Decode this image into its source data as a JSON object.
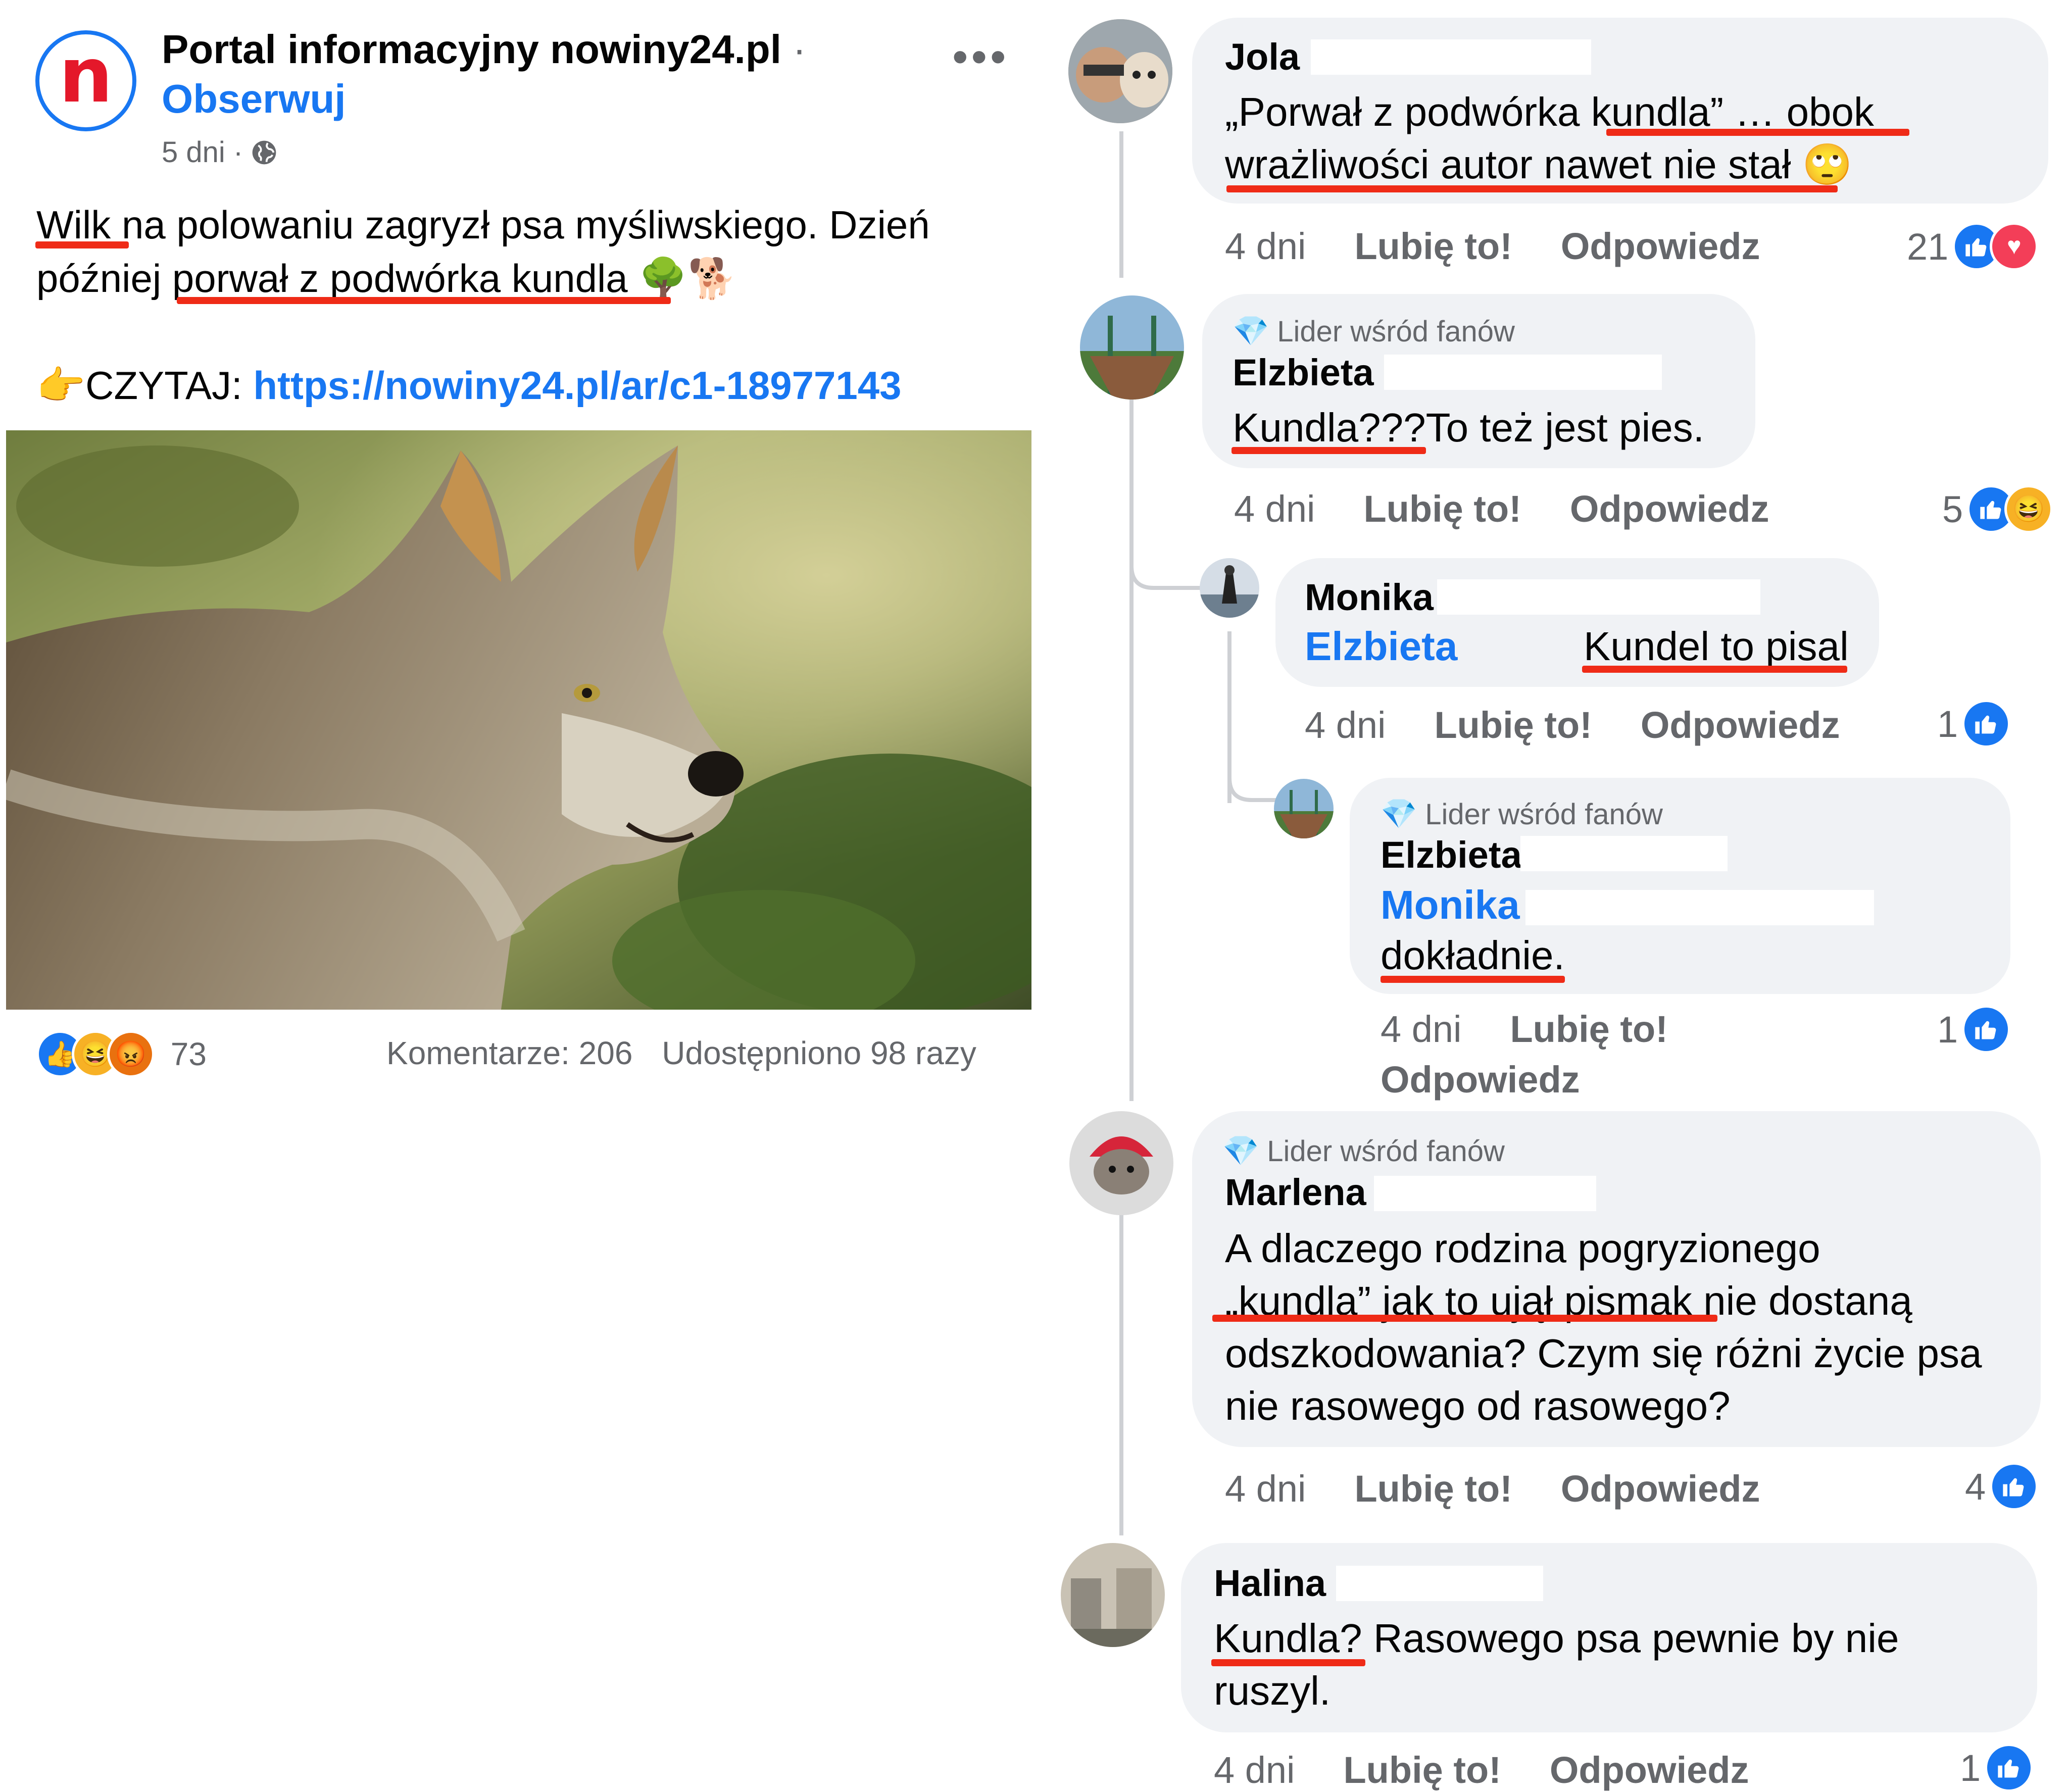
{
  "post": {
    "page_name": "Portal informacyjny nowiny24.pl",
    "separator": "·",
    "follow_label": "Obserwuj",
    "time": "5 dni ·",
    "text_line1": "Wilk na polowaniu zagryzł psa myśliwskiego. Dzień",
    "text_line2": "później porwał z podwórka kundla",
    "text_line2_emoji": "🌳🐕",
    "read_prefix": "👉CZYTAJ: ",
    "read_link": "https://nowiny24.pl/ar/c1-18977143",
    "reaction_count": "73",
    "comments_label": "Komentarze: 206",
    "shares_label": "Udostępniono 98 razy"
  },
  "comments": [
    {
      "name": "Jola",
      "line1": "„Porwał z podwórka kundla” … obok",
      "line2": "wrażliwości autor nawet nie stał",
      "emoji": "🙄",
      "time": "4 dni",
      "like": "Lubię to!",
      "reply": "Odpowiedz",
      "reactions": "21"
    },
    {
      "fan_badge": "Lider wśród fanów",
      "name": "Elzbieta",
      "line1": "Kundla???To też jest pies.",
      "time": "4 dni",
      "like": "Lubię to!",
      "reply": "Odpowiedz",
      "reactions": "5"
    },
    {
      "name": "Monika",
      "mention": "Elzbieta",
      "line1": "Kundel to pisal",
      "time": "4 dni",
      "like": "Lubię to!",
      "reply": "Odpowiedz",
      "reactions": "1"
    },
    {
      "fan_badge": "Lider wśród fanów",
      "name": "Elzbieta",
      "mention": "Monika",
      "line1": "dokładnie.",
      "time": "4 dni",
      "like": "Lubię to!",
      "reply": "Odpowiedz",
      "reactions": "1"
    },
    {
      "fan_badge": "Lider wśród fanów",
      "name": "Marlena",
      "line1": "A dlaczego rodzina pogryzionego",
      "line2": "„kundla” jak to ujął pismak nie dostaną",
      "line3": "odszkodowania? Czym się różni życie psa",
      "line4": "nie rasowego od rasowego?",
      "time": "4 dni",
      "like": "Lubię to!",
      "reply": "Odpowiedz",
      "reactions": "4"
    },
    {
      "name": "Halina",
      "line1": "Kundla? Rasowego psa pewnie by nie",
      "line2": "ruszyl.",
      "time": "4 dni",
      "like": "Lubię to!",
      "reply": "Odpowiedz",
      "reactions": "1"
    }
  ],
  "colors": {
    "facebook_blue": "#1877f2",
    "highlight_red": "#ef2b17",
    "bubble_gray": "#f0f2f5",
    "meta_gray": "#65676b"
  }
}
